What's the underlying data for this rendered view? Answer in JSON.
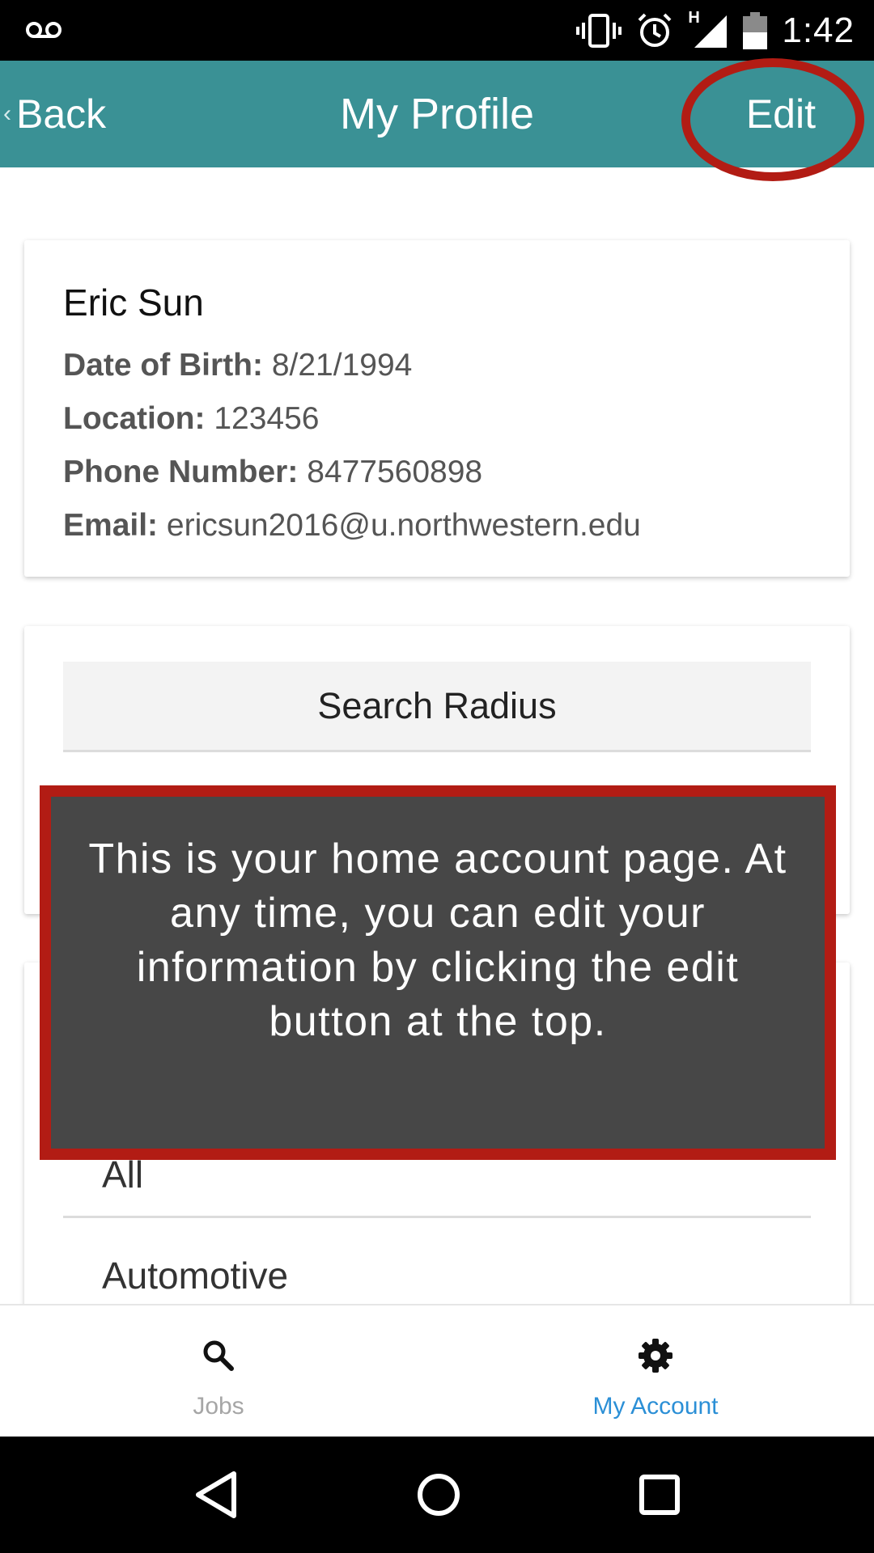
{
  "status_bar": {
    "time": "1:42",
    "network_label": "H"
  },
  "app_bar": {
    "back_label": "Back",
    "title": "My Profile",
    "edit_label": "Edit"
  },
  "profile": {
    "name": "Eric Sun",
    "dob_label": "Date of Birth:",
    "dob_value": "8/21/1994",
    "location_label": "Location:",
    "location_value": "123456",
    "phone_label": "Phone Number:",
    "phone_value": "8477560898",
    "email_label": "Email:",
    "email_value": "ericsun2016@u.northwestern.edu"
  },
  "search_radius": {
    "label": "Search Radius"
  },
  "categories": {
    "items": [
      "All",
      "Automotive"
    ]
  },
  "tutorial": {
    "text": "This is your home account page. At any time, you can edit your information by clicking the edit button at the top."
  },
  "bottom_nav": {
    "jobs_label": "Jobs",
    "account_label": "My Account"
  },
  "colors": {
    "app_bar": "#3a9195",
    "highlight": "#b21c14",
    "active_tab": "#2b8fd6",
    "inactive_tab": "#a6a6a6"
  }
}
